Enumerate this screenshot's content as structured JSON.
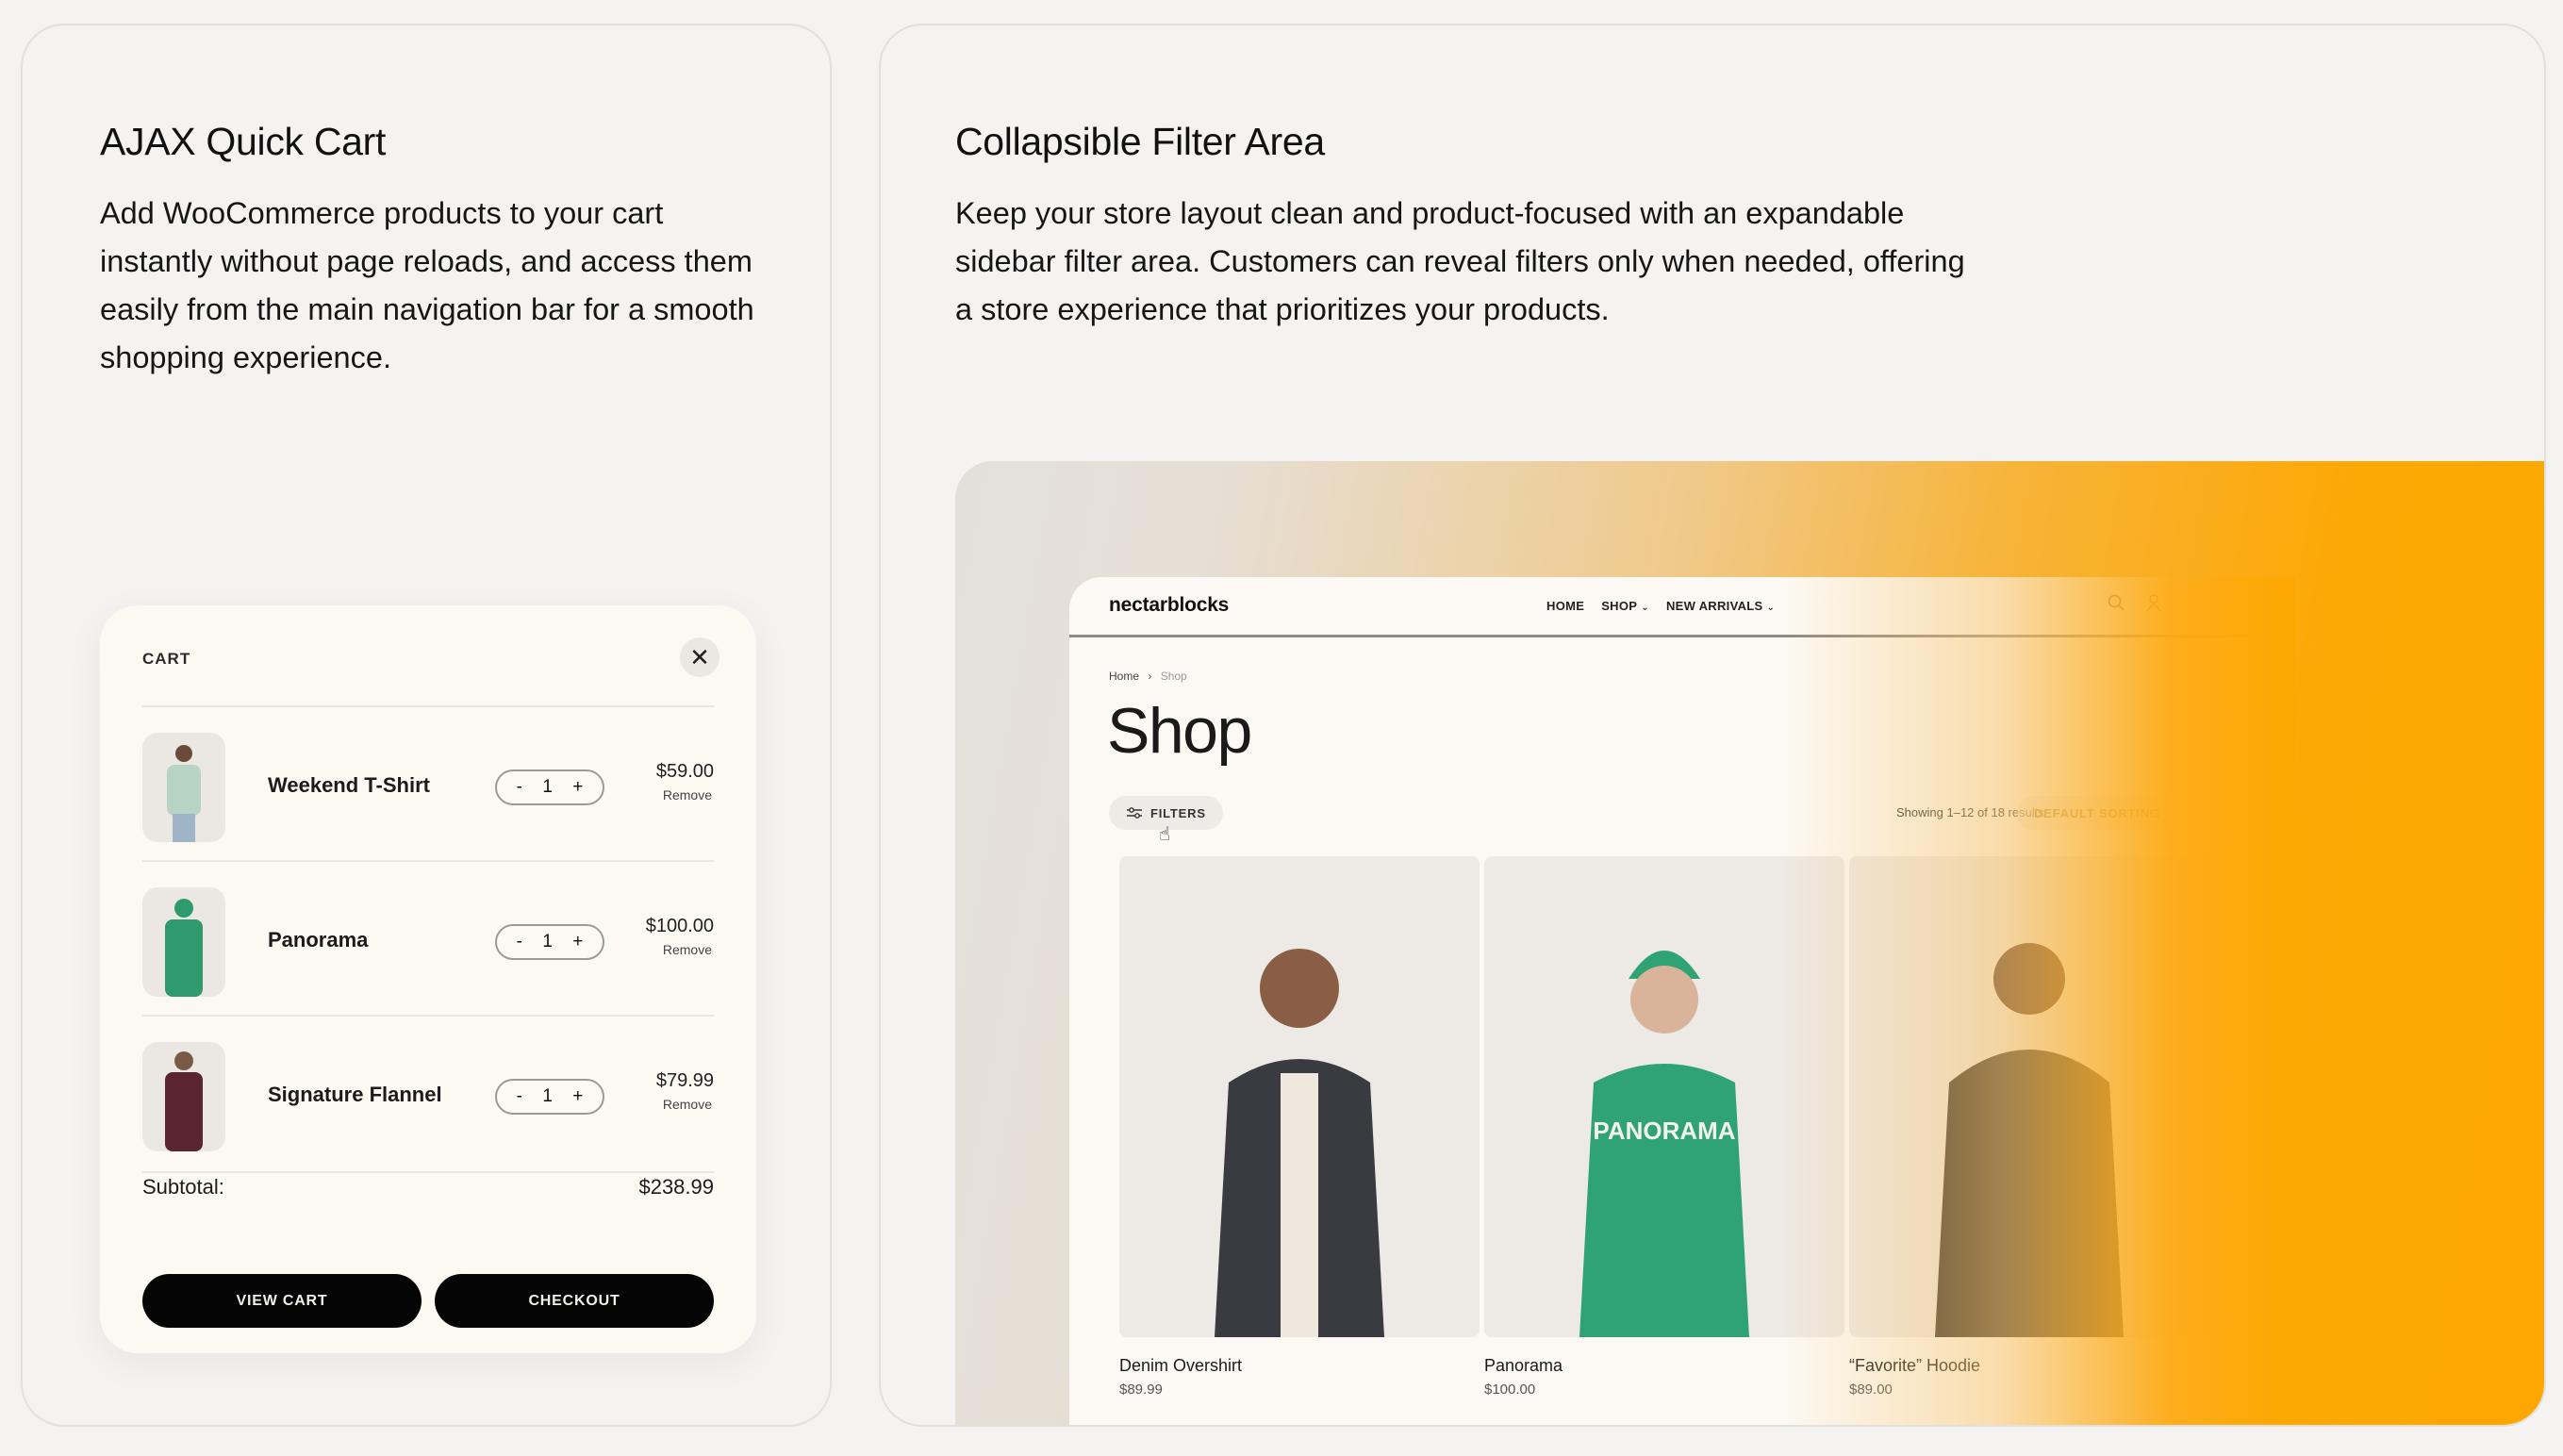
{
  "left_panel": {
    "title": "AJAX Quick Cart",
    "body": "Add WooCommerce products to your cart instantly without page reloads, and access them easily from the main navigation bar for a smooth shopping experience.",
    "cart": {
      "title": "CART",
      "close_icon": "close-icon",
      "items": [
        {
          "name": "Weekend T-Shirt",
          "qty": "1",
          "price": "$59.00",
          "remove": "Remove",
          "minus": "-",
          "plus": "+",
          "color": "#b7d3c4"
        },
        {
          "name": "Panorama",
          "qty": "1",
          "price": "$100.00",
          "remove": "Remove",
          "minus": "-",
          "plus": "+",
          "color": "#2f9a6c"
        },
        {
          "name": "Signature Flannel",
          "qty": "1",
          "price": "$79.99",
          "remove": "Remove",
          "minus": "-",
          "plus": "+",
          "color": "#5a2431"
        }
      ],
      "subtotal_label": "Subtotal:",
      "subtotal_value": "$238.99",
      "view_cart_label": "VIEW CART",
      "checkout_label": "CHECKOUT"
    }
  },
  "right_panel": {
    "title": "Collapsible Filter Area",
    "body": "Keep your store layout clean and product-focused with an expandable sidebar filter area. Customers can reveal filters only when needed, offering a store experience that prioritizes your products.",
    "store": {
      "logo": "nectarblocks",
      "menu": [
        {
          "label": "HOME",
          "has_dropdown": false
        },
        {
          "label": "SHOP",
          "has_dropdown": true
        },
        {
          "label": "NEW ARRIVALS",
          "has_dropdown": true
        }
      ],
      "icons": [
        "search-icon",
        "user-icon"
      ],
      "breadcrumb": {
        "home": "Home",
        "separator": "›",
        "current": "Shop"
      },
      "page_title": "Shop",
      "filters_label": "FILTERS",
      "results_text": "Showing 1–12 of 18 results",
      "sorting_label": "DEFAULT SORTING",
      "products": [
        {
          "name": "Denim Overshirt",
          "price": "$89.99",
          "color": "#3a3b40"
        },
        {
          "name": "Panorama",
          "price": "$100.00",
          "color": "#2fa374"
        },
        {
          "name": "“Favorite” Hoodie",
          "price": "$89.00",
          "color": "#3b342c"
        }
      ]
    },
    "accent_color": "#fea700"
  }
}
